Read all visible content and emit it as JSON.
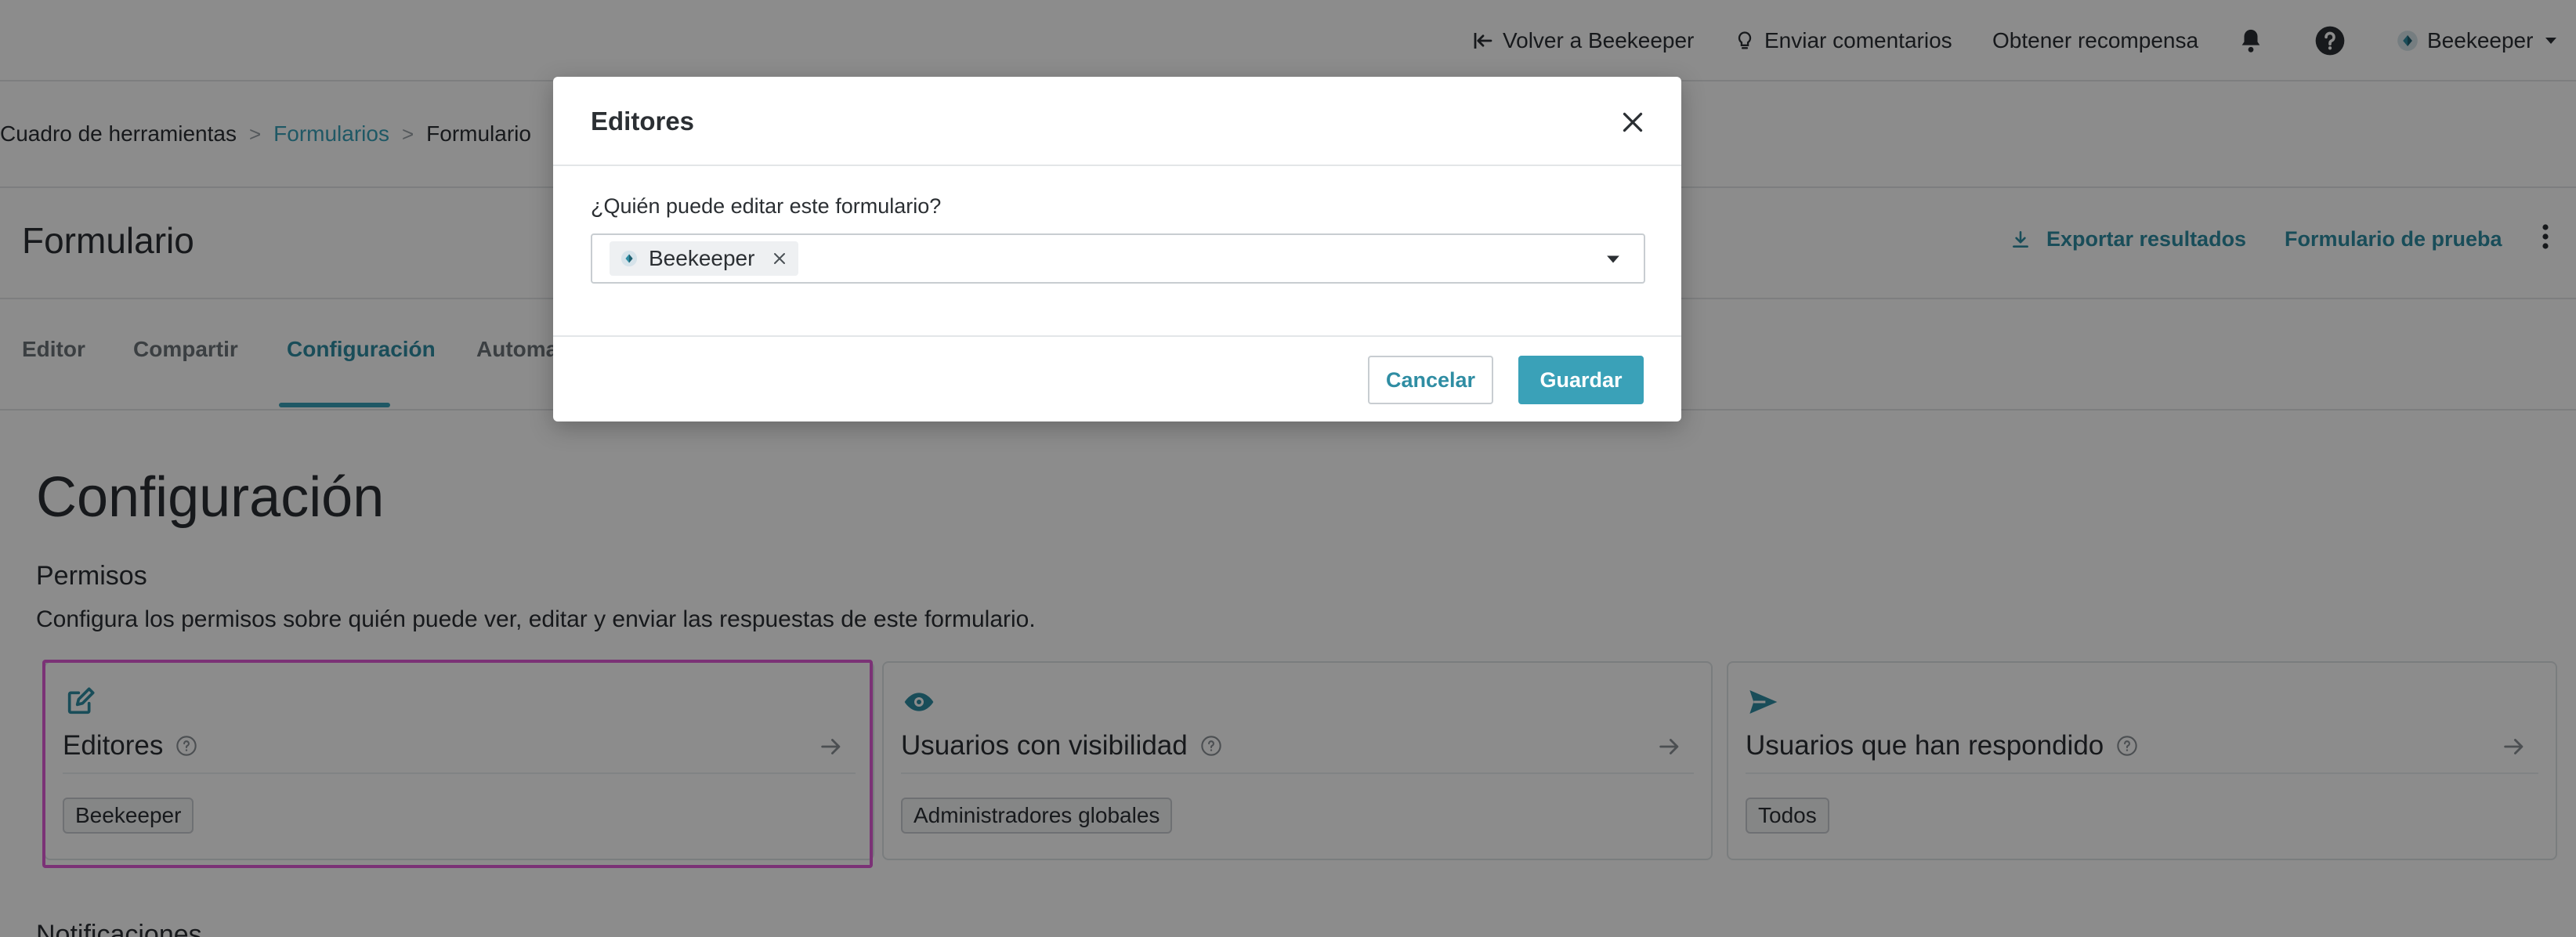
{
  "topbar": {
    "back_label": "Volver a Beekeeper",
    "feedback_label": "Enviar comentarios",
    "reward_label": "Obtener recompensa",
    "user_label": "Beekeeper"
  },
  "breadcrumb": {
    "items": [
      "Cuadro de herramientas",
      "Formularios",
      "Formulario"
    ],
    "separator": ">"
  },
  "page": {
    "title": "Formulario",
    "export_label": "Exportar resultados",
    "test_label": "Formulario de prueba"
  },
  "tabs": {
    "items": [
      "Editor",
      "Compartir",
      "Configuración",
      "Automa"
    ],
    "active": "Configuración"
  },
  "settings": {
    "title": "Configuración",
    "section_title": "Permisos",
    "section_desc": "Configura los permisos sobre quién puede ver, editar y enviar las respuestas de este formulario.",
    "cards": [
      {
        "title": "Editores",
        "chip": "Beekeeper",
        "icon": "edit-icon"
      },
      {
        "title": "Usuarios con visibilidad",
        "chip": "Administradores globales",
        "icon": "eye-icon"
      },
      {
        "title": "Usuarios que han respondido",
        "chip": "Todos",
        "icon": "send-icon"
      }
    ],
    "next_section_partial": "Notificaciones"
  },
  "modal": {
    "title": "Editores",
    "label": "¿Quién puede editar este formulario?",
    "selected_chip": "Beekeeper",
    "cancel_label": "Cancelar",
    "save_label": "Guardar"
  },
  "colors": {
    "accent": "#3aa1b8",
    "accent_text": "#2f8da3",
    "highlight": "#e05bd8",
    "overlay": "rgba(0,0,0,0.45)"
  }
}
